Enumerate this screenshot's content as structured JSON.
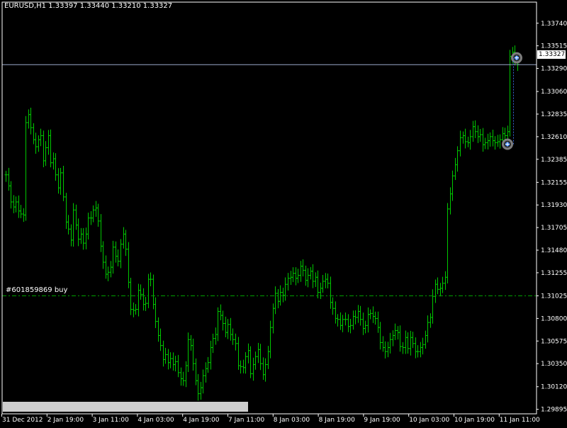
{
  "header": {
    "title": "EURUSD,H1  1.33397 1.33440 1.33210 1.33327"
  },
  "order": {
    "label": "#601859869 buy"
  },
  "price_box": {
    "value": "1.33327"
  },
  "colors": {
    "background": "#000000",
    "frame": "#ffffff",
    "bars": "#00c800",
    "order_line": "#00a000",
    "bid_line": "#9aa7c9",
    "text": "#ffffff"
  },
  "chart_data": {
    "type": "bar",
    "subtype": "ohlc",
    "title": "EURUSD,H1",
    "header_values": {
      "open": 1.33397,
      "high": 1.3344,
      "low": 1.3321,
      "close": 1.33327
    },
    "ylim": [
      1.2985,
      1.3395
    ],
    "y_ticks": [
      "1.33740",
      "1.33515",
      "1.33290",
      "1.33060",
      "1.32835",
      "1.32610",
      "1.32385",
      "1.32155",
      "1.31930",
      "1.31705",
      "1.31480",
      "1.31255",
      "1.31025",
      "1.30800",
      "1.30575",
      "1.30350",
      "1.30120",
      "1.29895"
    ],
    "x_ticks": [
      "31 Dec 2012",
      "2 Jan 19:00",
      "3 Jan 11:00",
      "4 Jan 03:00",
      "4 Jan 19:00",
      "7 Jan 11:00",
      "8 Jan 03:00",
      "8 Jan 19:00",
      "9 Jan 19:00",
      "10 Jan 03:00",
      "10 Jan 19:00",
      "11 Jan 11:00"
    ],
    "grid": false,
    "current_price": 1.33327,
    "order_price": 1.31025,
    "trade_markers": [
      1.33395,
      1.32535
    ],
    "closes": [
      1.3223,
      1.3212,
      1.3196,
      1.3191,
      1.3196,
      1.3187,
      1.3184,
      1.3183,
      1.3275,
      1.3283,
      1.327,
      1.3258,
      1.3251,
      1.3258,
      1.3262,
      1.3237,
      1.325,
      1.3262,
      1.3235,
      1.3239,
      1.3223,
      1.321,
      1.3225,
      1.3201,
      1.3176,
      1.3169,
      1.3158,
      1.3188,
      1.3173,
      1.3159,
      1.3164,
      1.3155,
      1.3164,
      1.318,
      1.318,
      1.3188,
      1.319,
      1.3177,
      1.3152,
      1.3136,
      1.3124,
      1.3126,
      1.3131,
      1.3151,
      1.3142,
      1.3137,
      1.3154,
      1.3164,
      1.3149,
      1.3116,
      1.3089,
      1.3088,
      1.3089,
      1.3108,
      1.3104,
      1.3094,
      1.3095,
      1.3119,
      1.3119,
      1.3094,
      1.3077,
      1.3063,
      1.3053,
      1.3039,
      1.3044,
      1.3036,
      1.304,
      1.3034,
      1.3037,
      1.3026,
      1.302,
      1.3018,
      1.3033,
      1.3059,
      1.3053,
      1.3035,
      1.3018,
      1.3005,
      1.3011,
      1.3023,
      1.303,
      1.3036,
      1.3051,
      1.306,
      1.3064,
      1.3087,
      1.3083,
      1.3075,
      1.3066,
      1.3074,
      1.3064,
      1.3059,
      1.3055,
      1.3033,
      1.3032,
      1.3031,
      1.3042,
      1.3048,
      1.3025,
      1.3034,
      1.3042,
      1.3049,
      1.3035,
      1.3024,
      1.3034,
      1.3047,
      1.3071,
      1.309,
      1.3105,
      1.3097,
      1.3106,
      1.3103,
      1.3114,
      1.312,
      1.3121,
      1.3125,
      1.312,
      1.3123,
      1.3132,
      1.3128,
      1.3118,
      1.3123,
      1.3127,
      1.3117,
      1.3121,
      1.3106,
      1.311,
      1.3117,
      1.3119,
      1.3115,
      1.3096,
      1.309,
      1.308,
      1.3079,
      1.3073,
      1.3079,
      1.3079,
      1.3072,
      1.3073,
      1.3082,
      1.3081,
      1.3087,
      1.3079,
      1.307,
      1.3073,
      1.3084,
      1.3085,
      1.3082,
      1.308,
      1.3071,
      1.3056,
      1.3051,
      1.3047,
      1.3051,
      1.3059,
      1.3063,
      1.3068,
      1.3066,
      1.3052,
      1.3051,
      1.3061,
      1.305,
      1.3061,
      1.3055,
      1.3047,
      1.3047,
      1.3051,
      1.3054,
      1.3063,
      1.3076,
      1.3081,
      1.3102,
      1.3114,
      1.3109,
      1.311,
      1.3115,
      1.3121,
      1.3189,
      1.3204,
      1.3222,
      1.3233,
      1.3247,
      1.326,
      1.3262,
      1.3256,
      1.3255,
      1.3261,
      1.3271,
      1.3266,
      1.3261,
      1.3263,
      1.3253,
      1.3255,
      1.3257,
      1.3261,
      1.3257,
      1.3255,
      1.3256,
      1.3258,
      1.3264,
      1.3262,
      1.3266,
      1.3341,
      1.3345,
      1.3337,
      1.3333
    ]
  }
}
